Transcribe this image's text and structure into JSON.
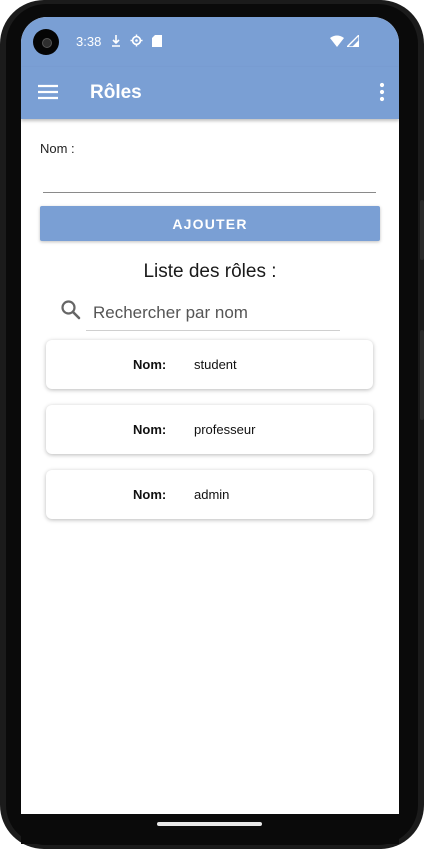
{
  "status_bar": {
    "time": "3:38",
    "icons_left": [
      "download-arrow-icon",
      "gear-icon",
      "sd-card-icon"
    ],
    "icons_right": [
      "wifi-icon",
      "signal-icon"
    ]
  },
  "toolbar": {
    "title": "Rôles",
    "menu_icon": "hamburger-menu-icon",
    "overflow_icon": "more-vert-icon",
    "color": "#7a9fd4"
  },
  "form": {
    "name_label": "Nom  :",
    "name_value": "",
    "add_button_label": "AJOUTER"
  },
  "list": {
    "title": "Liste des rôles :",
    "search_placeholder": "Rechercher par nom",
    "search_icon": "search-icon",
    "roles": [
      {
        "key": "Nom:",
        "value": "student"
      },
      {
        "key": "Nom:",
        "value": "professeur"
      },
      {
        "key": "Nom:",
        "value": "admin"
      }
    ]
  }
}
